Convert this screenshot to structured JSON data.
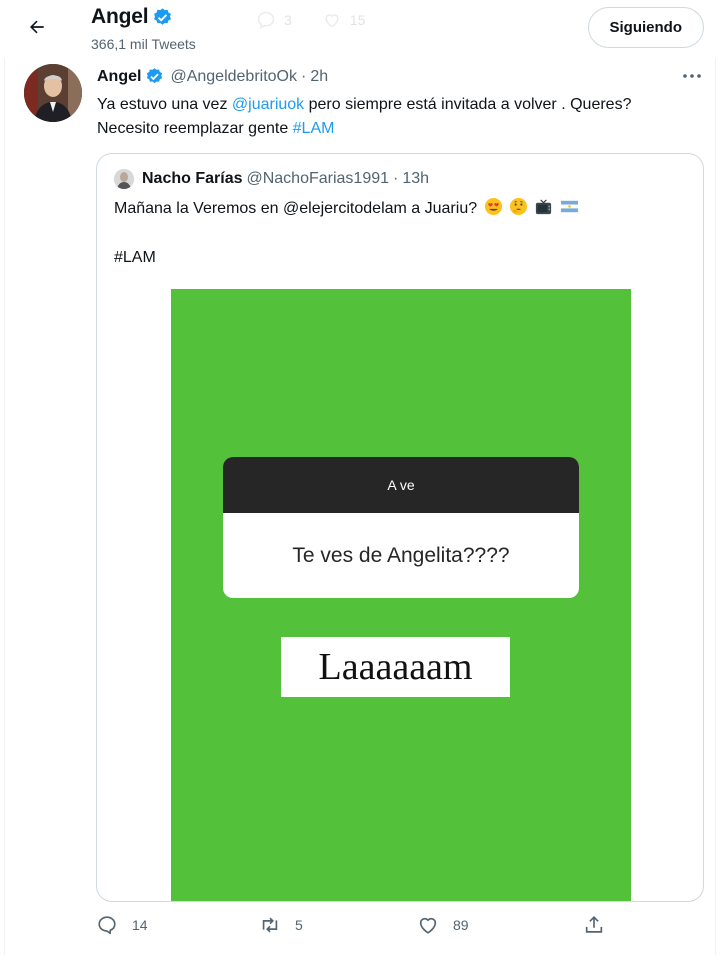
{
  "header": {
    "name": "Angel",
    "tweet_count": "366,1 mil Tweets",
    "follow_label": "Siguiendo",
    "ghost_counts": [
      "3",
      "15"
    ]
  },
  "tweet": {
    "author_name": "Angel",
    "handle": "@AngeldebritoOk",
    "separator": "·",
    "time": "2h",
    "text_part1": "Ya estuvo una vez ",
    "mention": "@juariuok",
    "text_part2": " pero siempre está invitada a volver . Queres? Necesito reemplazar gente ",
    "hashtag": "#LAM"
  },
  "quote": {
    "author_name": "Nacho Farías",
    "handle": "@NachoFarias1991",
    "separator": "·",
    "time": "13h",
    "text": "Mañana la Veremos en @elejercitodelam a Juariu?",
    "emojis": [
      "smiling-face-with-heart-eyes",
      "thinking-face",
      "television",
      "argentina-flag"
    ],
    "hashtag": "#LAM",
    "media": {
      "background_color": "#54c13b",
      "card_header": "A ve",
      "card_question": "Te ves de Angelita????",
      "answer_text": "Laaaaaam"
    }
  },
  "actions": {
    "reply_count": "14",
    "retweet_count": "5",
    "like_count": "89",
    "icons": [
      "reply-icon",
      "retweet-icon",
      "like-icon",
      "share-icon"
    ]
  },
  "colors": {
    "accent": "#1d9bf0",
    "verified": "#1d9bf0",
    "secondary_text": "#536471"
  }
}
